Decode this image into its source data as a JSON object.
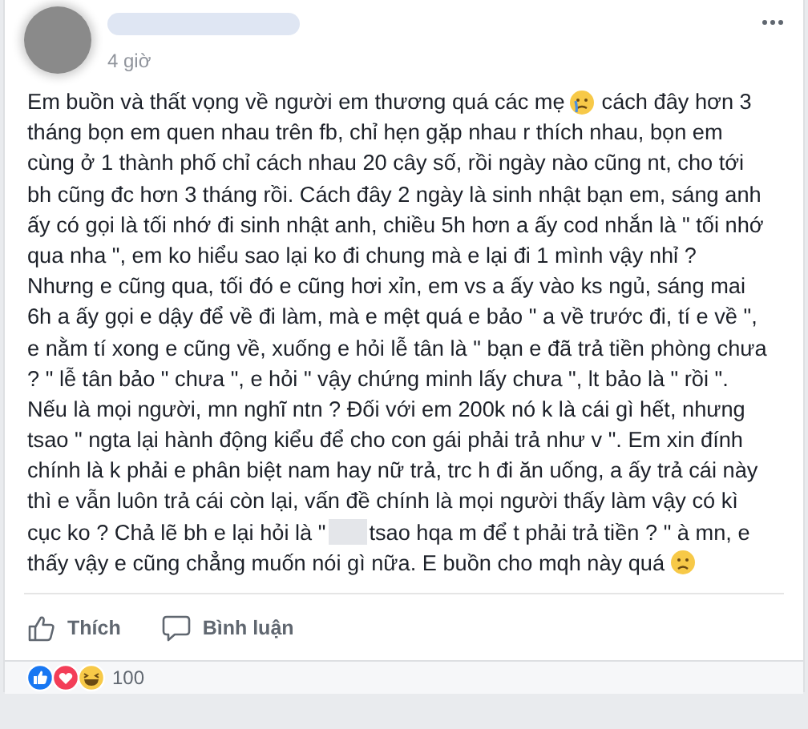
{
  "post": {
    "time": "4 giờ",
    "body_lines": [
      [
        {
          "kind": "text",
          "text": "Em buồn và thất vọng về người em thương quá các mẹ"
        },
        {
          "kind": "crying-emoji"
        },
        {
          "kind": "text",
          "text": "cách đây hơn 3"
        }
      ],
      [
        {
          "kind": "text",
          "text": "tháng bọn em quen nhau trên fb, chỉ hẹn gặp nhau r thích nhau, bọn em"
        }
      ],
      [
        {
          "kind": "text",
          "text": "cùng ở 1 thành phố chỉ cách nhau 20 cây số, rồi ngày nào cũng nt, cho tới"
        }
      ],
      [
        {
          "kind": "text",
          "text": "bh cũng đc hơn 3 tháng rồi. Cách đây 2 ngày là sinh nhật bạn em, sáng anh"
        }
      ],
      [
        {
          "kind": "text",
          "text": "ấy có gọi là tối nhớ đi sinh nhật anh, chiều 5h hơn a ấy cod nhắn là \" tối nhớ"
        }
      ],
      [
        {
          "kind": "text",
          "text": "qua nha \", em ko hiểu sao lại ko đi chung mà e lại đi 1 mình vậy nhỉ ?"
        }
      ],
      [
        {
          "kind": "text",
          "text": "Nhưng e cũng qua, tối đó e cũng hơi xỉn, em vs a ấy vào ks ngủ, sáng mai"
        }
      ],
      [
        {
          "kind": "text",
          "text": "6h a ấy gọi e dậy để về đi làm, mà e mệt quá e bảo \" a về trước đi, tí e về \","
        }
      ],
      [
        {
          "kind": "text",
          "text": "e nằm tí xong e cũng về, xuống e hỏi lễ tân là \" bạn e đã trả tiền phòng chưa"
        }
      ],
      [
        {
          "kind": "text",
          "text": "? \" lễ tân bảo \" chưa \", e hỏi \" vậy chứng minh lấy chưa \", lt bảo là \" rồi \"."
        }
      ],
      [
        {
          "kind": "text",
          "text": "Nếu là mọi người, mn nghĩ ntn ? Đối với em 200k nó k là cái gì hết, nhưng"
        }
      ],
      [
        {
          "kind": "text",
          "text": "tsao \" ngta lại hành động kiểu để cho con gái phải trả như v \". Em xin đính"
        }
      ],
      [
        {
          "kind": "text",
          "text": "chính là k phải e phân biệt nam hay nữ trả, trc h đi ăn uống, a ấy trả cái này"
        }
      ],
      [
        {
          "kind": "text",
          "text": "thì e vẫn luôn trả cái còn lại, vấn đề chính là mọi người thấy làm vậy có kì"
        }
      ],
      [
        {
          "kind": "text",
          "text": "cục ko ? Chả lẽ bh e lại hỏi là \""
        },
        {
          "kind": "redaction"
        },
        {
          "kind": "text",
          "text": "tsao hqa m để t phải trả tiền ? \" à mn, e"
        }
      ],
      [
        {
          "kind": "text",
          "text": "thấy vậy e cũng chẳng muốn nói gì nữa. E buồn cho mqh này quá"
        },
        {
          "kind": "sad-emoji"
        }
      ]
    ],
    "actions": [
      {
        "kind": "like",
        "label": "Thích"
      },
      {
        "kind": "comment",
        "label": "Bình luận"
      }
    ],
    "reactions": {
      "count": "100"
    }
  }
}
